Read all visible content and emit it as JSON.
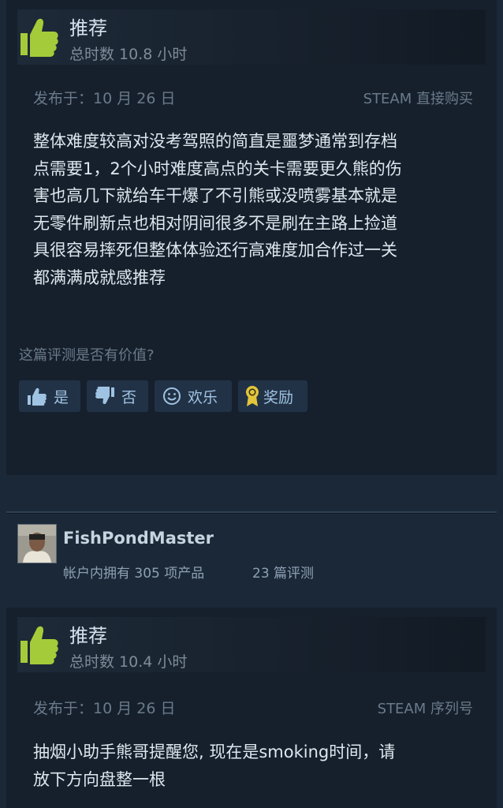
{
  "review1": {
    "recommendation": "推荐",
    "hours": "总时数 10.8 小时",
    "posted": "发布于：10 月 26 日",
    "source": "STEAM 直接购买",
    "text_lines": [
      "整体难度较高对没考驾照的简直是噩梦通常到存档",
      "点需要1，2个小时难度高点的关卡需要更久熊的伤",
      "害也高几下就给车干爆了不引熊或没喷雾基本就是",
      "无零件刷新点也相对阴间很多不是刷在主路上捡道",
      "具很容易摔死但整体体验还行高难度加合作过一关",
      "都满满成就感推荐"
    ],
    "helpful_question": "这篇评测是否有价值?",
    "buttons": {
      "yes": "是",
      "no": "否",
      "funny": "欢乐",
      "award": "奖励"
    }
  },
  "reviewer2": {
    "name": "FishPondMaster",
    "products": "帐户内拥有 305 项产品",
    "reviews": "23 篇评测"
  },
  "review2": {
    "recommendation": "推荐",
    "hours": "总时数 10.4 小时",
    "posted": "发布于：10 月 26 日",
    "source": "STEAM 序列号",
    "text_lines": [
      "抽烟小助手熊哥提醒您, 现在是smoking时间，请",
      "放下方向盘整一根"
    ]
  },
  "colors": {
    "thumb_green": "#a4cc3a",
    "button_bg": "#223246",
    "card_bg": "#16202d",
    "page_bg": "#1b2838"
  },
  "icons": {
    "recommend": "thumbs-up-icon",
    "yes": "thumbs-up-icon",
    "no": "thumbs-down-icon",
    "funny": "smiley-icon",
    "award": "award-ribbon-icon"
  }
}
